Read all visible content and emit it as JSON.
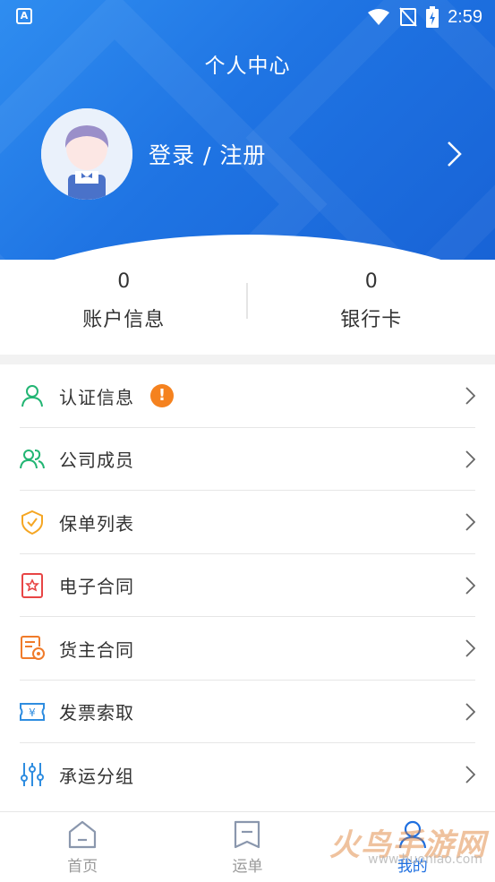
{
  "status_bar": {
    "time": "2:59"
  },
  "header": {
    "title": "个人中心",
    "login_label": "登录 / 注册"
  },
  "stats": [
    {
      "value": "0",
      "label": "账户信息"
    },
    {
      "value": "0",
      "label": "银行卡"
    }
  ],
  "menu": [
    {
      "label": "认证信息",
      "icon": "user-verify-icon"
    },
    {
      "label": "公司成员",
      "icon": "group-icon"
    },
    {
      "label": "保单列表",
      "icon": "shield-check-icon"
    },
    {
      "label": "电子合同",
      "icon": "contract-icon"
    },
    {
      "label": "货主合同",
      "icon": "document-seal-icon"
    },
    {
      "label": "发票索取",
      "icon": "invoice-icon"
    },
    {
      "label": "承运分组",
      "icon": "sliders-icon"
    }
  ],
  "bottom_nav": [
    {
      "label": "首页",
      "icon": "home-icon",
      "active": false
    },
    {
      "label": "运单",
      "icon": "waybill-icon",
      "active": false
    },
    {
      "label": "我的",
      "icon": "user-icon",
      "active": true
    }
  ],
  "colors": {
    "primary": "#1e6fe0",
    "green": "#22b573",
    "orange": "#f5821f",
    "red": "#e84545"
  }
}
